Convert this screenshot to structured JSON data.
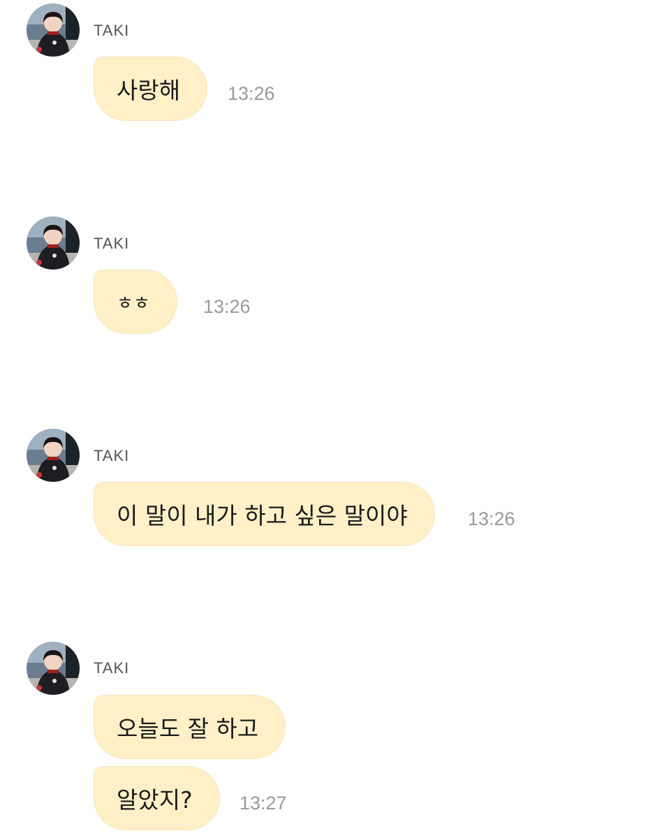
{
  "messages": [
    {
      "sender": "TAKI",
      "bubbles": [
        "사랑해"
      ],
      "time": "13:26"
    },
    {
      "sender": "TAKI",
      "bubbles": [
        "ㅎㅎ"
      ],
      "time": "13:26"
    },
    {
      "sender": "TAKI",
      "bubbles": [
        "이 말이 내가 하고 싶은 말이야"
      ],
      "time": "13:26"
    },
    {
      "sender": "TAKI",
      "bubbles": [
        "오늘도 잘 하고",
        "알았지?"
      ],
      "time": "13:27"
    }
  ],
  "colors": {
    "bubble_bg": "#fff0c8",
    "time_text": "#9a9a9a",
    "sender_text": "#555555"
  },
  "icons": {
    "avatar": "profile-photo"
  }
}
